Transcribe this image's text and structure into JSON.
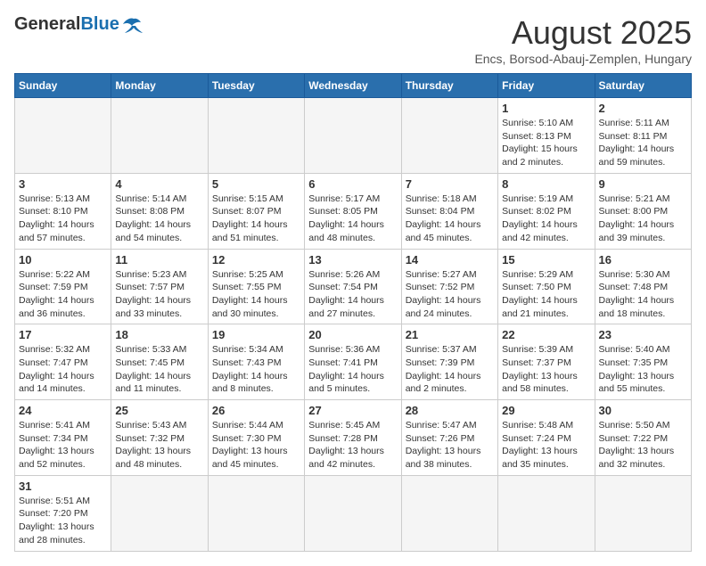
{
  "header": {
    "logo": {
      "general": "General",
      "blue": "Blue"
    },
    "title": "August 2025",
    "subtitle": "Encs, Borsod-Abauj-Zemplen, Hungary"
  },
  "weekdays": [
    "Sunday",
    "Monday",
    "Tuesday",
    "Wednesday",
    "Thursday",
    "Friday",
    "Saturday"
  ],
  "weeks": [
    [
      {
        "day": "",
        "info": ""
      },
      {
        "day": "",
        "info": ""
      },
      {
        "day": "",
        "info": ""
      },
      {
        "day": "",
        "info": ""
      },
      {
        "day": "",
        "info": ""
      },
      {
        "day": "1",
        "info": "Sunrise: 5:10 AM\nSunset: 8:13 PM\nDaylight: 15 hours and 2 minutes."
      },
      {
        "day": "2",
        "info": "Sunrise: 5:11 AM\nSunset: 8:11 PM\nDaylight: 14 hours and 59 minutes."
      }
    ],
    [
      {
        "day": "3",
        "info": "Sunrise: 5:13 AM\nSunset: 8:10 PM\nDaylight: 14 hours and 57 minutes."
      },
      {
        "day": "4",
        "info": "Sunrise: 5:14 AM\nSunset: 8:08 PM\nDaylight: 14 hours and 54 minutes."
      },
      {
        "day": "5",
        "info": "Sunrise: 5:15 AM\nSunset: 8:07 PM\nDaylight: 14 hours and 51 minutes."
      },
      {
        "day": "6",
        "info": "Sunrise: 5:17 AM\nSunset: 8:05 PM\nDaylight: 14 hours and 48 minutes."
      },
      {
        "day": "7",
        "info": "Sunrise: 5:18 AM\nSunset: 8:04 PM\nDaylight: 14 hours and 45 minutes."
      },
      {
        "day": "8",
        "info": "Sunrise: 5:19 AM\nSunset: 8:02 PM\nDaylight: 14 hours and 42 minutes."
      },
      {
        "day": "9",
        "info": "Sunrise: 5:21 AM\nSunset: 8:00 PM\nDaylight: 14 hours and 39 minutes."
      }
    ],
    [
      {
        "day": "10",
        "info": "Sunrise: 5:22 AM\nSunset: 7:59 PM\nDaylight: 14 hours and 36 minutes."
      },
      {
        "day": "11",
        "info": "Sunrise: 5:23 AM\nSunset: 7:57 PM\nDaylight: 14 hours and 33 minutes."
      },
      {
        "day": "12",
        "info": "Sunrise: 5:25 AM\nSunset: 7:55 PM\nDaylight: 14 hours and 30 minutes."
      },
      {
        "day": "13",
        "info": "Sunrise: 5:26 AM\nSunset: 7:54 PM\nDaylight: 14 hours and 27 minutes."
      },
      {
        "day": "14",
        "info": "Sunrise: 5:27 AM\nSunset: 7:52 PM\nDaylight: 14 hours and 24 minutes."
      },
      {
        "day": "15",
        "info": "Sunrise: 5:29 AM\nSunset: 7:50 PM\nDaylight: 14 hours and 21 minutes."
      },
      {
        "day": "16",
        "info": "Sunrise: 5:30 AM\nSunset: 7:48 PM\nDaylight: 14 hours and 18 minutes."
      }
    ],
    [
      {
        "day": "17",
        "info": "Sunrise: 5:32 AM\nSunset: 7:47 PM\nDaylight: 14 hours and 14 minutes."
      },
      {
        "day": "18",
        "info": "Sunrise: 5:33 AM\nSunset: 7:45 PM\nDaylight: 14 hours and 11 minutes."
      },
      {
        "day": "19",
        "info": "Sunrise: 5:34 AM\nSunset: 7:43 PM\nDaylight: 14 hours and 8 minutes."
      },
      {
        "day": "20",
        "info": "Sunrise: 5:36 AM\nSunset: 7:41 PM\nDaylight: 14 hours and 5 minutes."
      },
      {
        "day": "21",
        "info": "Sunrise: 5:37 AM\nSunset: 7:39 PM\nDaylight: 14 hours and 2 minutes."
      },
      {
        "day": "22",
        "info": "Sunrise: 5:39 AM\nSunset: 7:37 PM\nDaylight: 13 hours and 58 minutes."
      },
      {
        "day": "23",
        "info": "Sunrise: 5:40 AM\nSunset: 7:35 PM\nDaylight: 13 hours and 55 minutes."
      }
    ],
    [
      {
        "day": "24",
        "info": "Sunrise: 5:41 AM\nSunset: 7:34 PM\nDaylight: 13 hours and 52 minutes."
      },
      {
        "day": "25",
        "info": "Sunrise: 5:43 AM\nSunset: 7:32 PM\nDaylight: 13 hours and 48 minutes."
      },
      {
        "day": "26",
        "info": "Sunrise: 5:44 AM\nSunset: 7:30 PM\nDaylight: 13 hours and 45 minutes."
      },
      {
        "day": "27",
        "info": "Sunrise: 5:45 AM\nSunset: 7:28 PM\nDaylight: 13 hours and 42 minutes."
      },
      {
        "day": "28",
        "info": "Sunrise: 5:47 AM\nSunset: 7:26 PM\nDaylight: 13 hours and 38 minutes."
      },
      {
        "day": "29",
        "info": "Sunrise: 5:48 AM\nSunset: 7:24 PM\nDaylight: 13 hours and 35 minutes."
      },
      {
        "day": "30",
        "info": "Sunrise: 5:50 AM\nSunset: 7:22 PM\nDaylight: 13 hours and 32 minutes."
      }
    ],
    [
      {
        "day": "31",
        "info": "Sunrise: 5:51 AM\nSunset: 7:20 PM\nDaylight: 13 hours and 28 minutes."
      },
      {
        "day": "",
        "info": ""
      },
      {
        "day": "",
        "info": ""
      },
      {
        "day": "",
        "info": ""
      },
      {
        "day": "",
        "info": ""
      },
      {
        "day": "",
        "info": ""
      },
      {
        "day": "",
        "info": ""
      }
    ]
  ]
}
